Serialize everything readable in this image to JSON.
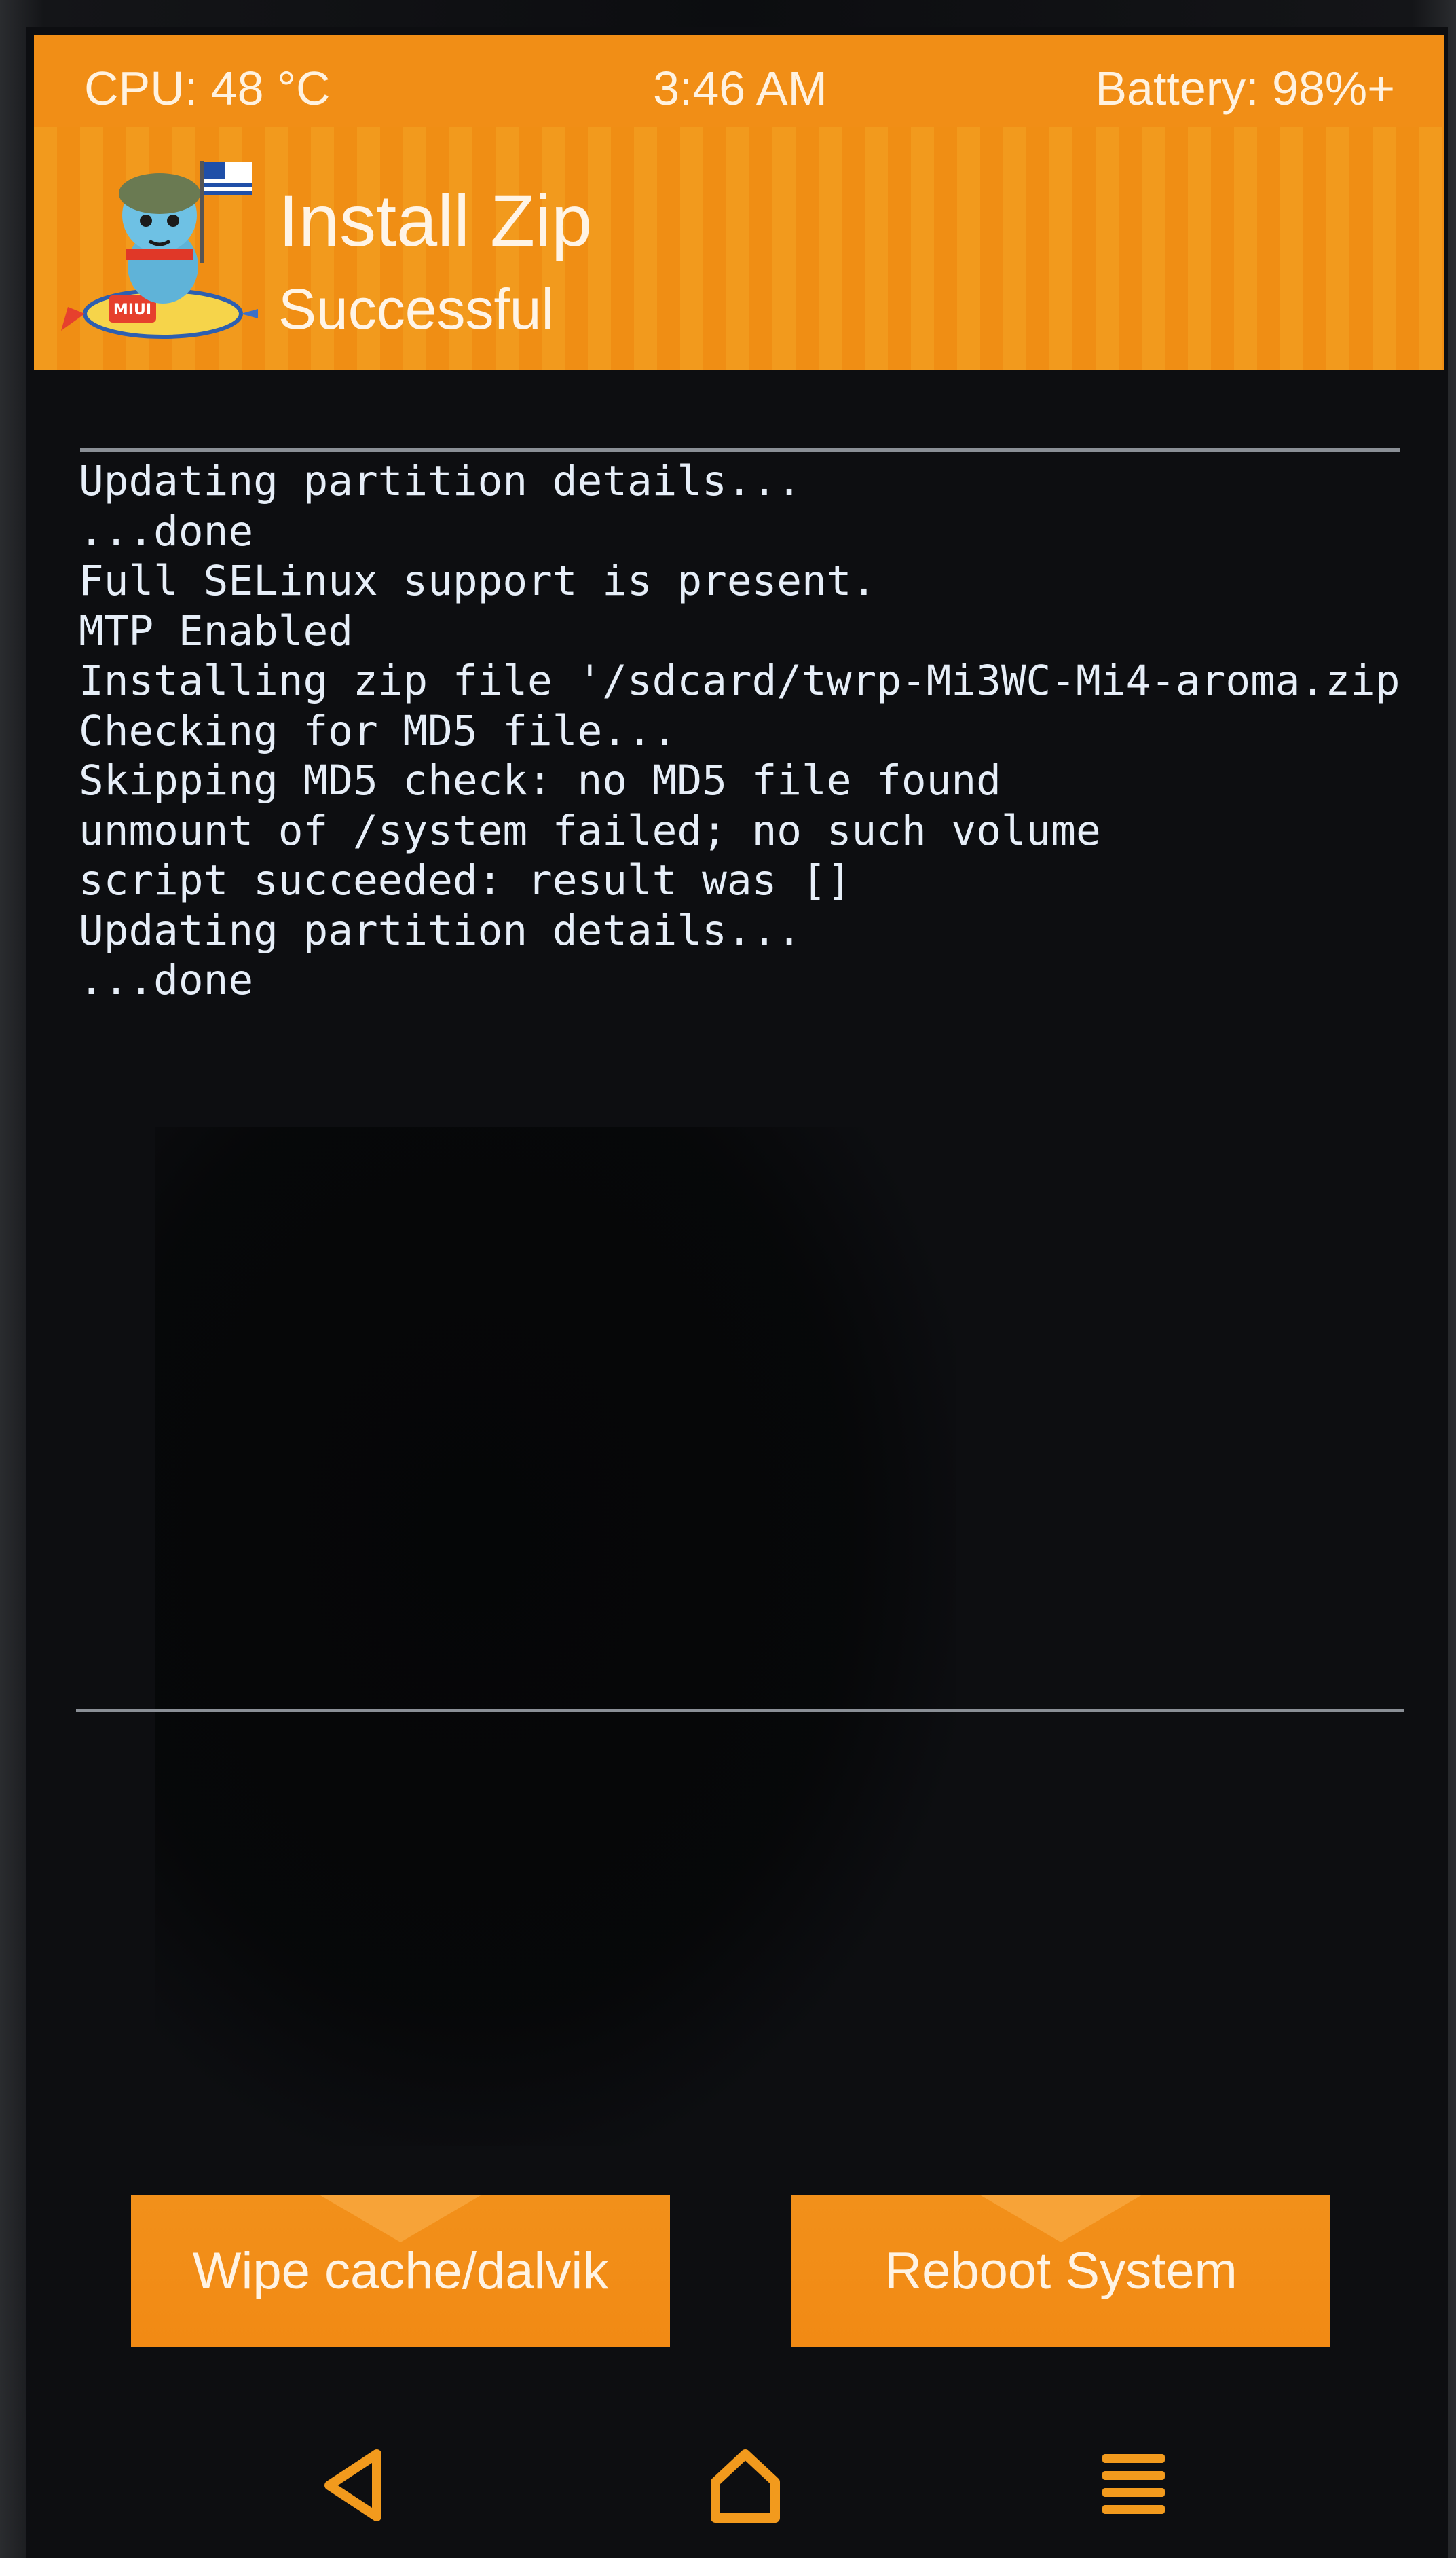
{
  "status_bar": {
    "cpu": "CPU: 48 °C",
    "time": "3:46 AM",
    "battery": "Battery: 98%+"
  },
  "header": {
    "title": "Install Zip",
    "subtitle": "Successful",
    "logo_text": "MIUI"
  },
  "console": {
    "lines": [
      "Updating partition details...",
      "...done",
      "Full SELinux support is present.",
      "MTP Enabled",
      "Installing zip file '/sdcard/twrp-Mi3WC-Mi4-aroma.zip",
      "Checking for MD5 file...",
      "Skipping MD5 check: no MD5 file found",
      "unmount of /system failed; no such volume",
      "script succeeded: result was []",
      "Updating partition details...",
      "...done"
    ]
  },
  "buttons": {
    "wipe": "Wipe cache/dalvik",
    "reboot": "Reboot System"
  },
  "nav": {
    "back_icon": "back-triangle-icon",
    "home_icon": "home-icon",
    "menu_icon": "menu-icon"
  },
  "colors": {
    "accent": "#f18e16",
    "console_text": "#e6eef8",
    "background": "#0d0e11"
  }
}
